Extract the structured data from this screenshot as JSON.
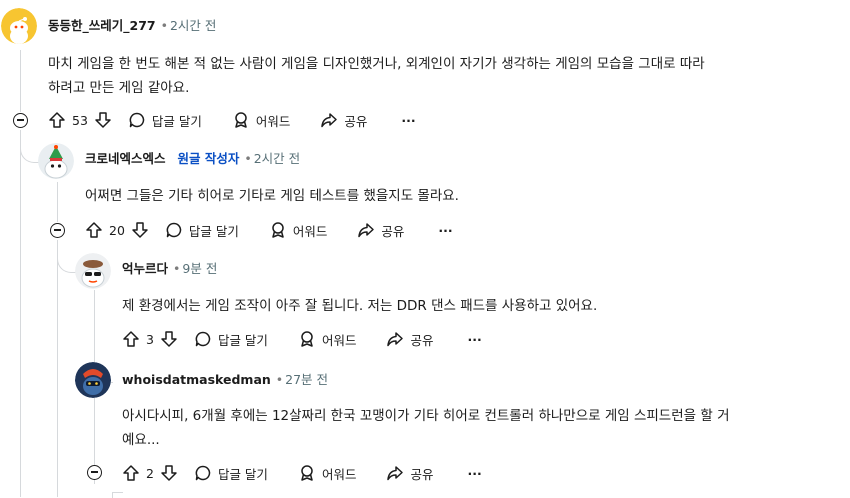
{
  "comments": [
    {
      "username": "동등한_쓰레기_277",
      "time": "2시간 전",
      "body_line1": "마치 게임을 한 번도 해본 적 없는 사람이 게임을 디자인했거나, 외계인이 자기가 생각하는 게임의 모습을 그대로 따라",
      "body_line2": "하려고 만든 게임 같아요.",
      "votes": "53",
      "reply_label": "답글 달기",
      "award_label": "어워드",
      "share_label": "공유",
      "more_label": "···"
    },
    {
      "username": "크로네엑스엑스",
      "op_badge": "원글 작성자",
      "time": "2시간 전",
      "body_line1": "어쩌면 그들은 기타 히어로 기타로 게임 테스트를 했을지도 몰라요.",
      "votes": "20",
      "reply_label": "답글 달기",
      "award_label": "어워드",
      "share_label": "공유",
      "more_label": "···"
    },
    {
      "username": "억누르다",
      "time": "9분 전",
      "body_line1": "제 환경에서는 게임 조작이 아주 잘 됩니다. 저는 DDR 댄스 패드를 사용하고 있어요.",
      "votes": "3",
      "reply_label": "답글 달기",
      "award_label": "어워드",
      "share_label": "공유",
      "more_label": "···"
    },
    {
      "username": "whoisdatmaskedman",
      "time": "27분 전",
      "body_line1": "아시다시피, 6개월 후에는 12살짜리 한국 꼬맹이가 기타 히어로 컨트롤러 하나만으로 게임 스피드런을 할 거",
      "body_line2": "예요...",
      "votes": "2",
      "reply_label": "답글 달기",
      "award_label": "어워드",
      "share_label": "공유",
      "more_label": "···"
    }
  ]
}
